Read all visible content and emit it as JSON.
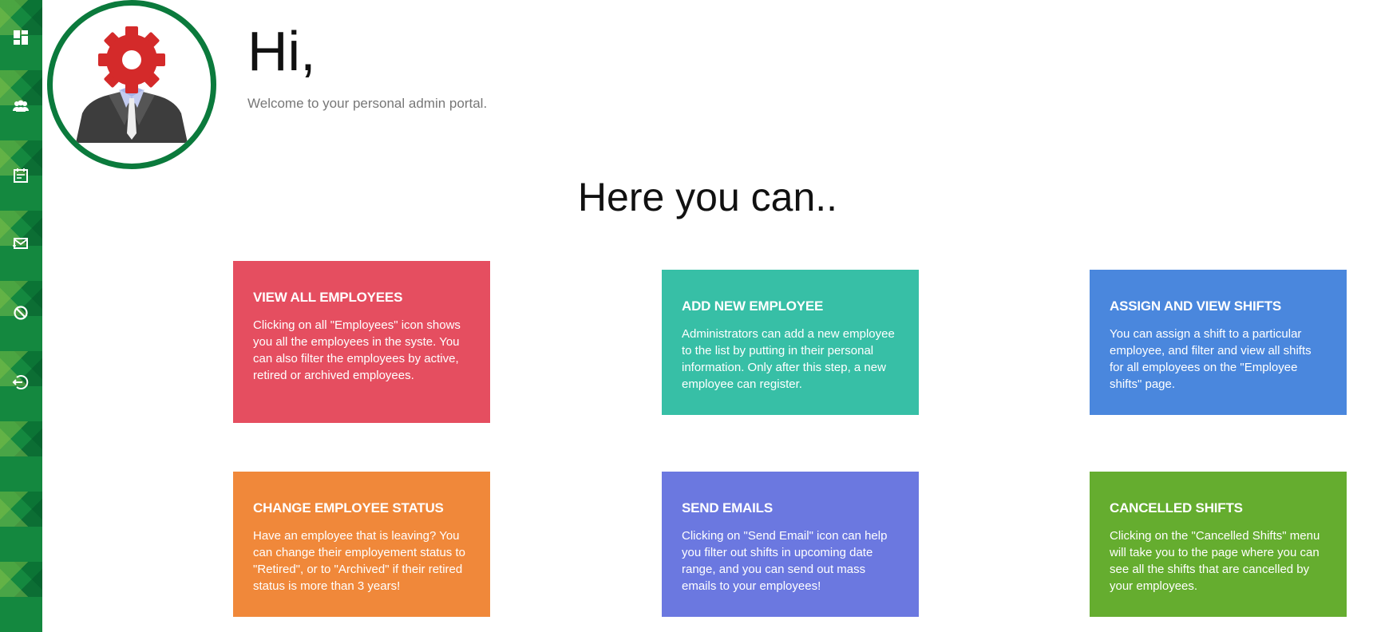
{
  "sidebar": {
    "items": [
      {
        "name": "dashboard-icon"
      },
      {
        "name": "employees-icon"
      },
      {
        "name": "shifts-calendar-icon"
      },
      {
        "name": "send-email-icon"
      },
      {
        "name": "cancelled-shifts-icon"
      },
      {
        "name": "logout-icon"
      }
    ]
  },
  "header": {
    "greeting": "Hi,",
    "welcome": "Welcome to your personal admin portal."
  },
  "main": {
    "title": "Here you can..",
    "cards": [
      {
        "title": "VIEW ALL EMPLOYEES",
        "text": "Clicking on all \"Employees\" icon shows you all the employees in the syste. You can also filter the employees by active, retired or archived employees.",
        "color": "#e54e60"
      },
      {
        "title": "ADD NEW EMPLOYEE",
        "text": "Administrators can add a new employee to the list by putting in their personal information. Only after this step, a new employee can register.",
        "color": "#37bfa6"
      },
      {
        "title": "ASSIGN AND VIEW SHIFTS",
        "text": "You can assign a shift to a particular employee, and filter and view all shifts for all employees on the \"Employee shifts\" page.",
        "color": "#4a87dd"
      },
      {
        "title": "CHANGE EMPLOYEE STATUS",
        "text": "Have an employee that is leaving? You can change their employement status to \"Retired\", or to \"Archived\" if their retired status is more than 3 years!",
        "color": "#f0883a"
      },
      {
        "title": "SEND EMAILS",
        "text": "Clicking on \"Send Email\" icon can help you filter out shifts in upcoming date range, and you can send out mass emails to your employees!",
        "color": "#6b78e0"
      },
      {
        "title": "CANCELLED SHIFTS",
        "text": "Clicking on the \"Cancelled Shifts\" menu will take you to the page where you can see all the shifts that are cancelled by your employees.",
        "color": "#65ad2f"
      }
    ]
  },
  "colors": {
    "sidebar": "#14883f",
    "avatar_ring": "#0b7a3c"
  }
}
